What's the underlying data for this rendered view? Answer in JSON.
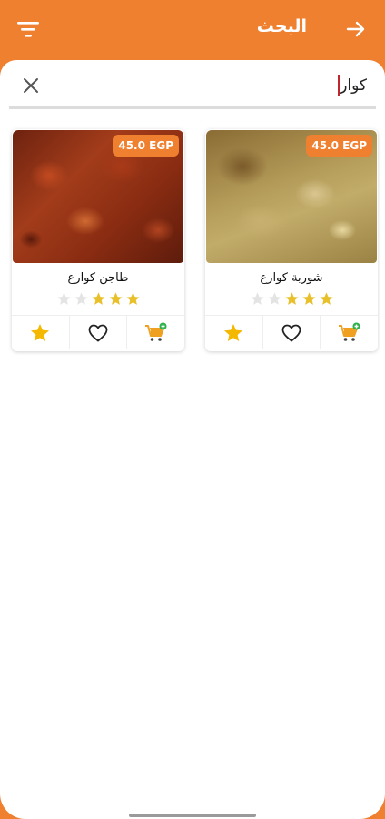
{
  "header": {
    "title": "البحث",
    "back_icon": "arrow-forward-icon",
    "filter_icon": "filter-icon",
    "color": "#ef8030"
  },
  "search": {
    "value": "كوار",
    "clear_icon": "close-icon"
  },
  "products": [
    {
      "name": "شوربة كوارع",
      "price": "45.0 EGP",
      "rating": 3,
      "rating_max": 5,
      "image": "soup-photo"
    },
    {
      "name": "طاجن كوارع",
      "price": "45.0 EGP",
      "rating": 3,
      "rating_max": 5,
      "image": "tagine-photo"
    }
  ],
  "colors": {
    "accent": "#ef8030",
    "star_filled": "#e8c02a",
    "star_empty": "#e4e4e4"
  }
}
